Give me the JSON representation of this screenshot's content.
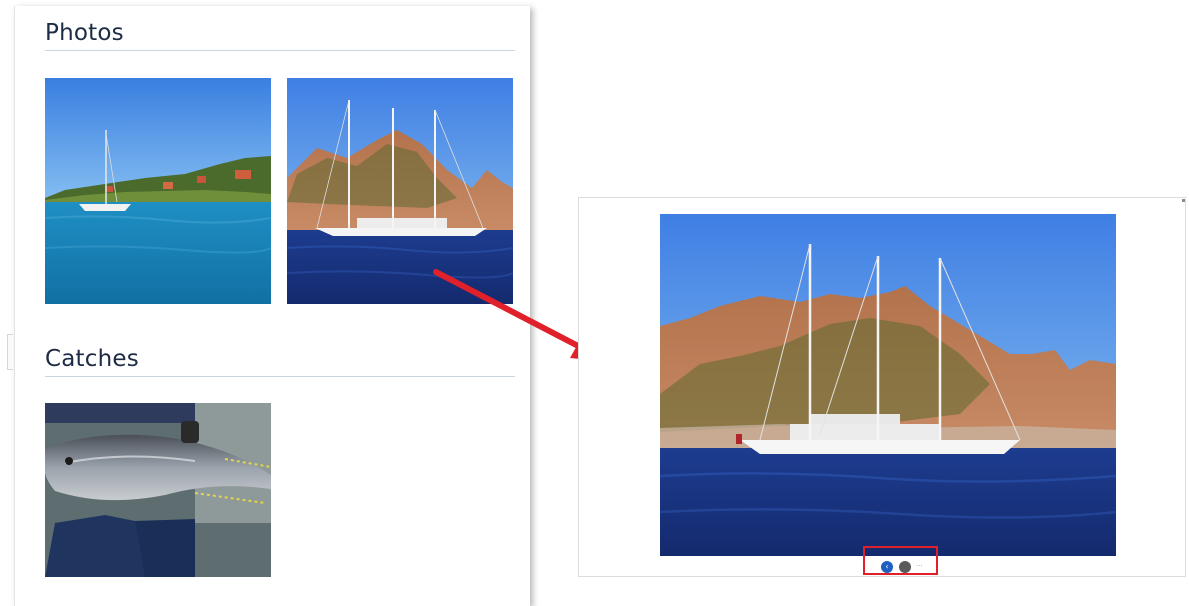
{
  "photos_section": {
    "title": "Photos"
  },
  "catches_section": {
    "title": "Catches"
  },
  "viewer": {
    "prev_icon": "chevron-left-icon",
    "next_icon": "circle-icon",
    "prev_glyph": "‹",
    "more_glyph": "···"
  },
  "colors": {
    "heading": "#1d2b44",
    "section_rule": "#c9d4e0",
    "arrow": "#e0202a",
    "highlight_box": "#e0202a",
    "viewer_prev_button": "#2160c0",
    "viewer_next_button": "#5a5a5a"
  }
}
